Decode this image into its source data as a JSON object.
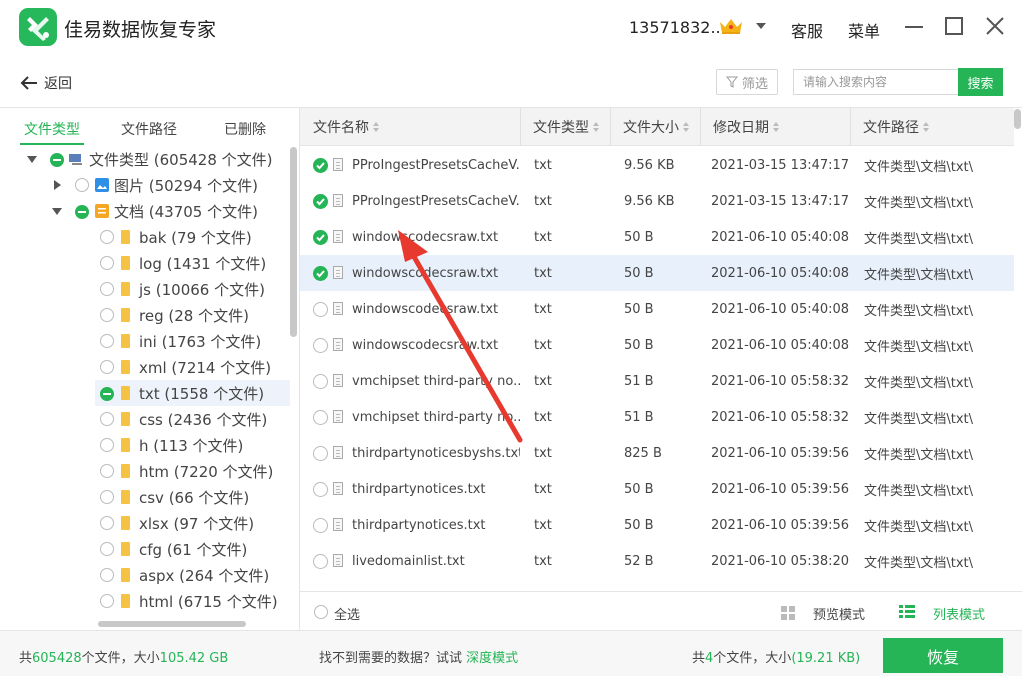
{
  "app": {
    "title": "佳易数据恢复专家",
    "user_id": "13571832...",
    "service": "客服",
    "menu": "菜单"
  },
  "toolbar": {
    "back": "返回",
    "filter": "筛选",
    "search_placeholder": "请输入搜索内容",
    "search_button": "搜索"
  },
  "left_tabs": [
    "文件类型",
    "文件路径",
    "已删除"
  ],
  "tree": {
    "root": "文件类型 (605428 个文件)",
    "images": "图片 (50294 个文件)",
    "docs": "文档 (43705 个文件)",
    "items": [
      "bak (79 个文件)",
      "log (1431 个文件)",
      "js (10066 个文件)",
      "reg (28 个文件)",
      "ini (1763 个文件)",
      "xml (7214 个文件)",
      "txt (1558 个文件)",
      "css (2436 个文件)",
      "h (113 个文件)",
      "htm (7220 个文件)",
      "csv (66 个文件)",
      "xlsx (97 个文件)",
      "cfg (61 个文件)",
      "aspx (264 个文件)",
      "html (6715 个文件)"
    ]
  },
  "table": {
    "columns": [
      "文件名称",
      "文件类型",
      "文件大小",
      "修改日期",
      "文件路径"
    ],
    "rows": [
      {
        "name": "PProIngestPresetsCacheV...",
        "type": "txt",
        "size": "9.56 KB",
        "date": "2021-03-15 13:47:17",
        "path": "文件类型\\文档\\txt\\"
      },
      {
        "name": "PProIngestPresetsCacheV...",
        "type": "txt",
        "size": "9.56 KB",
        "date": "2021-03-15 13:47:17",
        "path": "文件类型\\文档\\txt\\"
      },
      {
        "name": "windowscodecsraw.txt",
        "type": "txt",
        "size": "50 B",
        "date": "2021-06-10 05:40:08",
        "path": "文件类型\\文档\\txt\\"
      },
      {
        "name": "windowscodecsraw.txt",
        "type": "txt",
        "size": "50 B",
        "date": "2021-06-10 05:40:08",
        "path": "文件类型\\文档\\txt\\"
      },
      {
        "name": "windowscodecsraw.txt",
        "type": "txt",
        "size": "50 B",
        "date": "2021-06-10 05:40:08",
        "path": "文件类型\\文档\\txt\\"
      },
      {
        "name": "windowscodecsraw.txt",
        "type": "txt",
        "size": "50 B",
        "date": "2021-06-10 05:40:08",
        "path": "文件类型\\文档\\txt\\"
      },
      {
        "name": "vmchipset third-party no...",
        "type": "txt",
        "size": "51 B",
        "date": "2021-06-10 05:58:32",
        "path": "文件类型\\文档\\txt\\"
      },
      {
        "name": "vmchipset third-party no...",
        "type": "txt",
        "size": "51 B",
        "date": "2021-06-10 05:58:32",
        "path": "文件类型\\文档\\txt\\"
      },
      {
        "name": "thirdpartynoticesbyshs.txt",
        "type": "txt",
        "size": "825 B",
        "date": "2021-06-10 05:39:56",
        "path": "文件类型\\文档\\txt\\"
      },
      {
        "name": "thirdpartynotices.txt",
        "type": "txt",
        "size": "50 B",
        "date": "2021-06-10 05:39:56",
        "path": "文件类型\\文档\\txt\\"
      },
      {
        "name": "thirdpartynotices.txt",
        "type": "txt",
        "size": "50 B",
        "date": "2021-06-10 05:39:56",
        "path": "文件类型\\文档\\txt\\"
      },
      {
        "name": "livedomainlist.txt",
        "type": "txt",
        "size": "52 B",
        "date": "2021-06-10 05:38:20",
        "path": "文件类型\\文档\\txt\\"
      }
    ],
    "checked_rows": [
      0,
      1,
      2,
      3
    ],
    "selected_row": 3
  },
  "footer": {
    "select_all": "全选",
    "preview_mode": "预览模式",
    "list_mode": "列表模式"
  },
  "status": {
    "total_prefix": "共",
    "total_count": "605428",
    "total_mid": "个文件，大小",
    "total_size": "105.42 GB",
    "hint": "找不到需要的数据？试试",
    "deep_mode": "深度模式",
    "sel_prefix": "共",
    "sel_count": "4",
    "sel_mid": "个文件，大小",
    "sel_size": "(19.21 KB)",
    "recover": "恢复"
  },
  "colors": {
    "accent": "#25b456",
    "selected_row": "#e7f0fb",
    "annotation": "#e8392f"
  }
}
